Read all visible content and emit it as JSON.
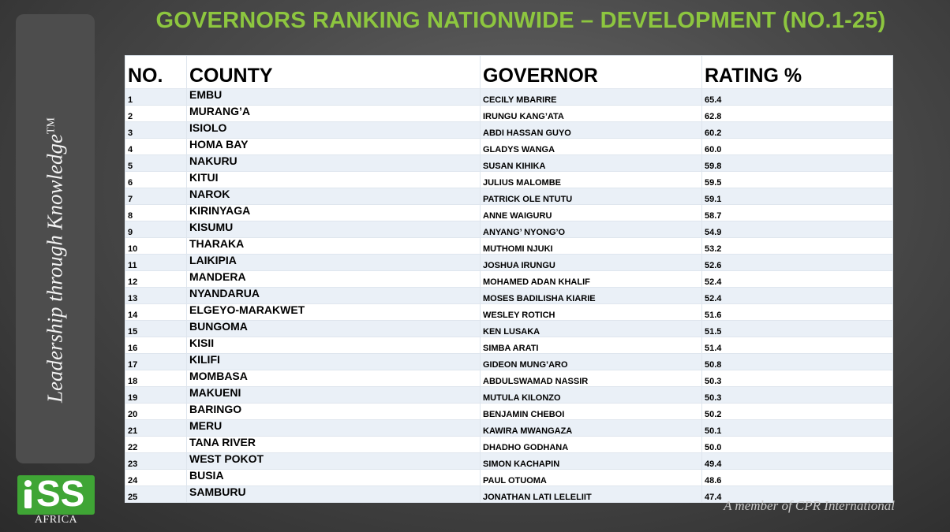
{
  "title": "GOVERNORS RANKING NATIONWIDE – DEVELOPMENT (NO.1-25)",
  "sidebar": {
    "tagline": "Leadership through Knowledge",
    "tm": "TM"
  },
  "logo": {
    "text": "SS",
    "sub": "AFRICA"
  },
  "footer": {
    "member": "A member of CPR International"
  },
  "table": {
    "headers": {
      "no": "NO.",
      "county": "COUNTY",
      "governor": "GOVERNOR",
      "rating": "RATING %"
    },
    "rows": [
      {
        "no": "1",
        "county": "EMBU",
        "governor": "CECILY MBARIRE",
        "rating": "65.4"
      },
      {
        "no": "2",
        "county": "MURANG’A",
        "governor": "IRUNGU KANG’ATA",
        "rating": "62.8"
      },
      {
        "no": "3",
        "county": "ISIOLO",
        "governor": "ABDI HASSAN GUYO",
        "rating": "60.2"
      },
      {
        "no": "4",
        "county": "HOMA BAY",
        "governor": "GLADYS WANGA",
        "rating": "60.0"
      },
      {
        "no": "5",
        "county": "NAKURU",
        "governor": "SUSAN KIHIKA",
        "rating": "59.8"
      },
      {
        "no": "6",
        "county": "KITUI",
        "governor": "JULIUS MALOMBE",
        "rating": "59.5"
      },
      {
        "no": "7",
        "county": "NAROK",
        "governor": "PATRICK OLE NTUTU",
        "rating": "59.1"
      },
      {
        "no": "8",
        "county": "KIRINYAGA",
        "governor": "ANNE WAIGURU",
        "rating": "58.7"
      },
      {
        "no": "9",
        "county": "KISUMU",
        "governor": "ANYANG’ NYONG’O",
        "rating": "54.9"
      },
      {
        "no": "10",
        "county": "THARAKA",
        "governor": "MUTHOMI NJUKI",
        "rating": "53.2"
      },
      {
        "no": "11",
        "county": "LAIKIPIA",
        "governor": "JOSHUA IRUNGU",
        "rating": "52.6"
      },
      {
        "no": "12",
        "county": "MANDERA",
        "governor": "MOHAMED ADAN KHALIF",
        "rating": "52.4"
      },
      {
        "no": "13",
        "county": "NYANDARUA",
        "governor": "MOSES BADILISHA KIARIE",
        "rating": "52.4"
      },
      {
        "no": "14",
        "county": "ELGEYO-MARAKWET",
        "governor": "WESLEY ROTICH",
        "rating": "51.6"
      },
      {
        "no": "15",
        "county": "BUNGOMA",
        "governor": "KEN LUSAKA",
        "rating": "51.5"
      },
      {
        "no": "16",
        "county": "KISII",
        "governor": "SIMBA ARATI",
        "rating": "51.4"
      },
      {
        "no": "17",
        "county": "KILIFI",
        "governor": "GIDEON MUNG’ARO",
        "rating": "50.8"
      },
      {
        "no": "18",
        "county": "MOMBASA",
        "governor": "ABDULSWAMAD NASSIR",
        "rating": "50.3"
      },
      {
        "no": "19",
        "county": "MAKUENI",
        "governor": "MUTULA KILONZO",
        "rating": "50.3"
      },
      {
        "no": "20",
        "county": "BARINGO",
        "governor": "BENJAMIN CHEBOI",
        "rating": "50.2"
      },
      {
        "no": "21",
        "county": "MERU",
        "governor": "KAWIRA MWANGAZA",
        "rating": "50.1"
      },
      {
        "no": "22",
        "county": "TANA RIVER",
        "governor": "DHADHO GODHANA",
        "rating": "50.0"
      },
      {
        "no": "23",
        "county": "WEST POKOT",
        "governor": "SIMON KACHAPIN",
        "rating": "49.4"
      },
      {
        "no": "24",
        "county": "BUSIA",
        "governor": "PAUL OTUOMA",
        "rating": "48.6"
      },
      {
        "no": "25",
        "county": "SAMBURU",
        "governor": "JONATHAN LATI LELELIIT",
        "rating": "47.4"
      }
    ]
  }
}
